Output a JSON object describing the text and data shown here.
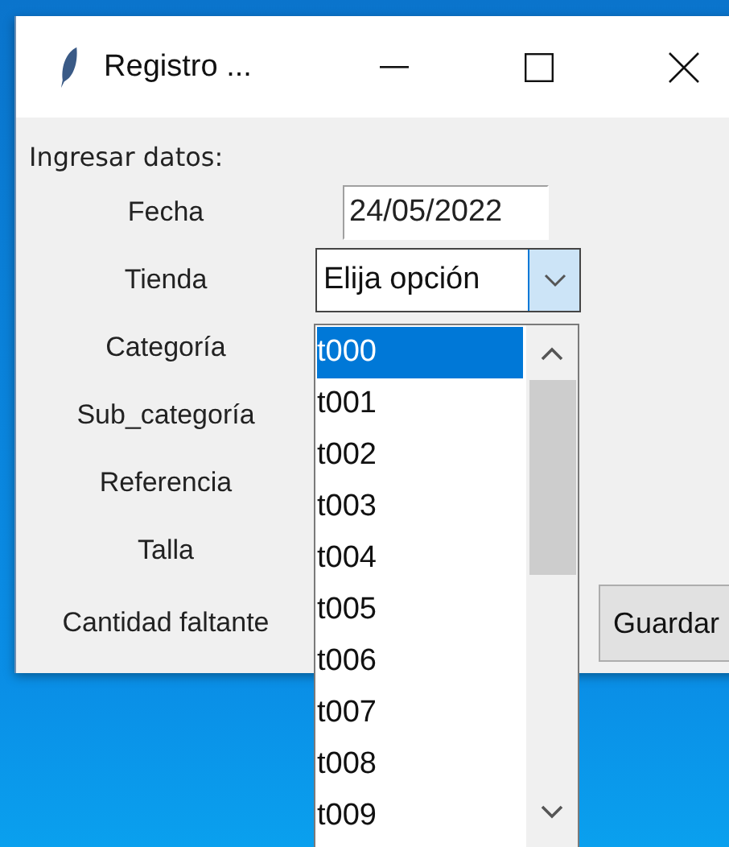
{
  "window": {
    "title": "Registro ..."
  },
  "heading": "Ingresar datos:",
  "fields": [
    {
      "label": "Fecha",
      "kind": "entry",
      "value": "24/05/2022"
    },
    {
      "label": "Tienda",
      "kind": "combobox",
      "value": "Elija opción"
    },
    {
      "label": "Categoría",
      "kind": "none"
    },
    {
      "label": "Sub_categoría",
      "kind": "none"
    },
    {
      "label": "Referencia",
      "kind": "none"
    },
    {
      "label": "Talla",
      "kind": "none"
    },
    {
      "label": "Cantidad faltante",
      "kind": "none"
    }
  ],
  "save_button": "Guardar",
  "dropdown": {
    "items": [
      {
        "label": "t000",
        "selected": true
      },
      {
        "label": "t001",
        "selected": false
      },
      {
        "label": "t002",
        "selected": false
      },
      {
        "label": "t003",
        "selected": false
      },
      {
        "label": "t004",
        "selected": false
      },
      {
        "label": "t005",
        "selected": false
      },
      {
        "label": "t006",
        "selected": false
      },
      {
        "label": "t007",
        "selected": false
      },
      {
        "label": "t008",
        "selected": false
      },
      {
        "label": "t009",
        "selected": false
      }
    ]
  }
}
